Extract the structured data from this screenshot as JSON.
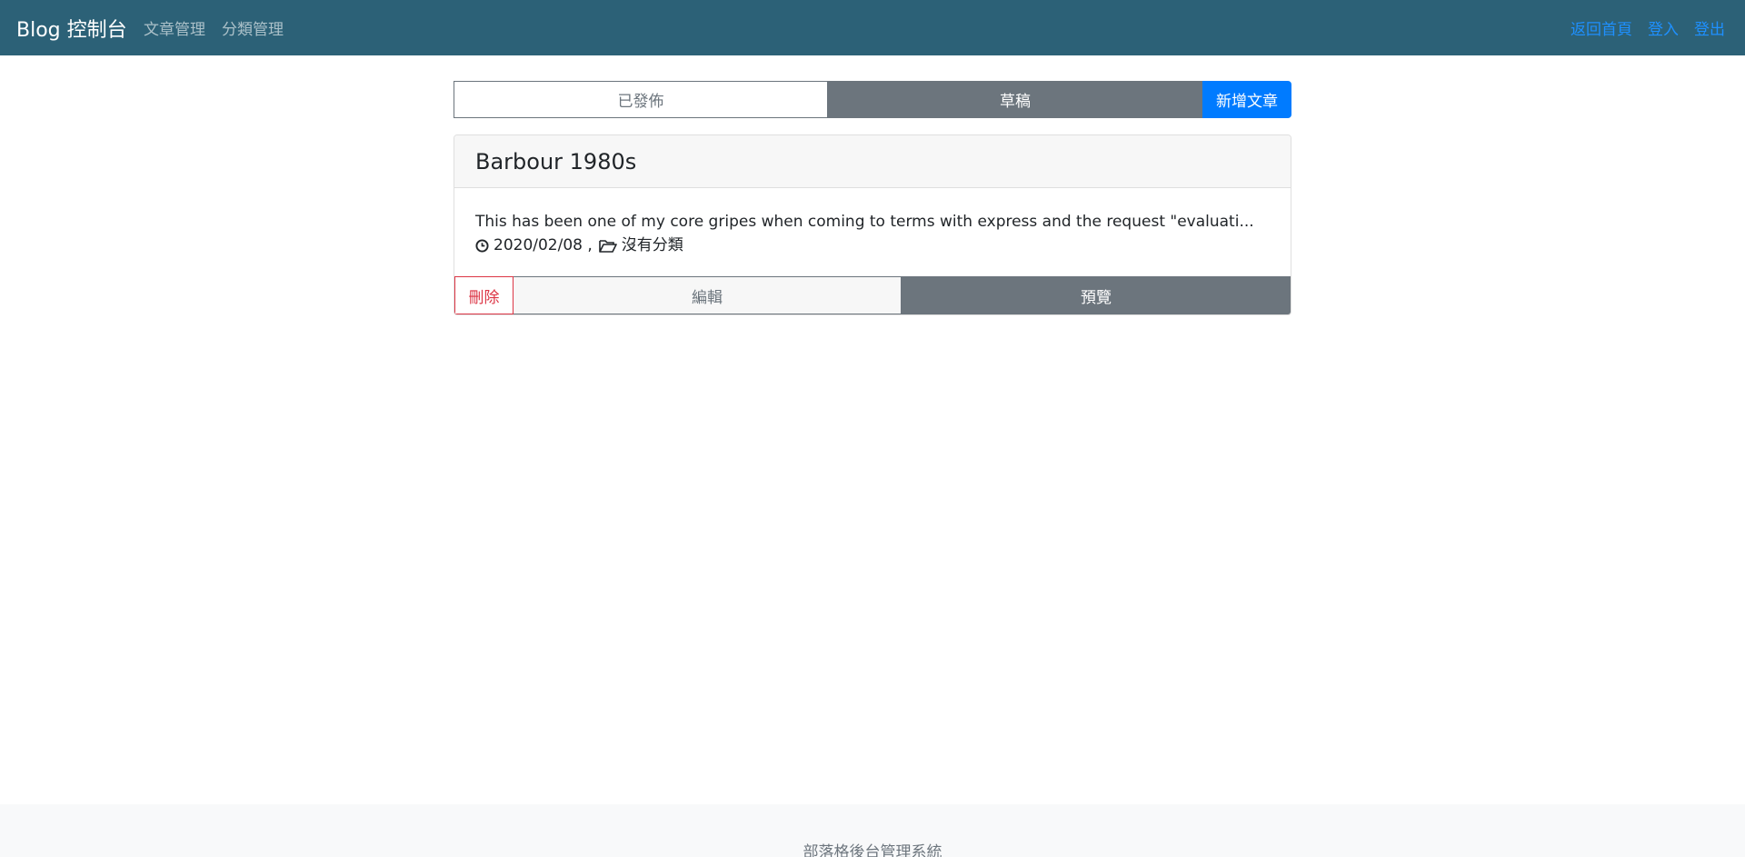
{
  "navbar": {
    "brand": "Blog 控制台",
    "left_links": [
      "文章管理",
      "分類管理"
    ],
    "right_links": [
      "返回首頁",
      "登入",
      "登出"
    ]
  },
  "tabs": {
    "published": "已發佈",
    "draft": "草稿",
    "new_post": "新增文章"
  },
  "post": {
    "title": "Barbour 1980s",
    "excerpt": "This has been one of my core gripes when coming to terms with express and the request \"evaluati...",
    "date": "2020/02/08 ,",
    "category": "沒有分類",
    "delete_label": "刪除",
    "edit_label": "編輯",
    "preview_label": "預覽"
  },
  "footer": {
    "text": "部落格後台管理系統"
  },
  "colors": {
    "navbar_bg": "#2c6177",
    "primary": "#007bff",
    "secondary": "#6c757d",
    "danger": "#dc3545"
  }
}
